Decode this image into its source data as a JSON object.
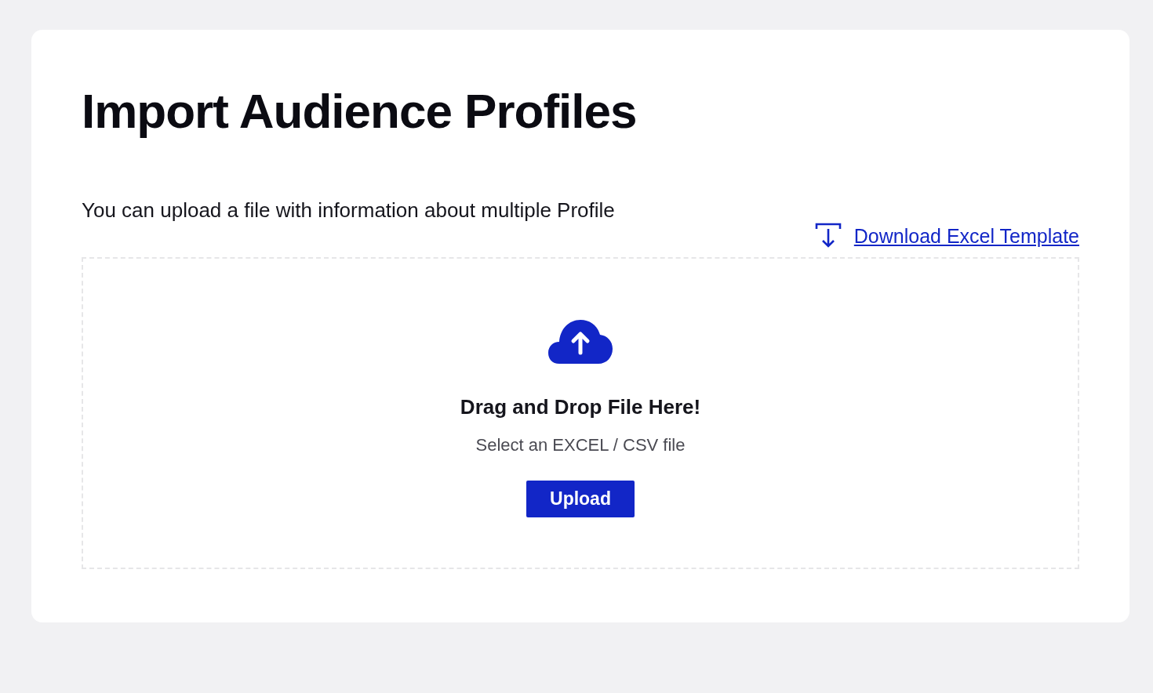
{
  "title": "Import Audience Profiles",
  "description": "You can upload a file with information about multiple Profile",
  "template_link": {
    "label": "Download Excel Template"
  },
  "dropzone": {
    "heading": "Drag and Drop File Here!",
    "hint": "Select an EXCEL / CSV file",
    "button": "Upload"
  }
}
